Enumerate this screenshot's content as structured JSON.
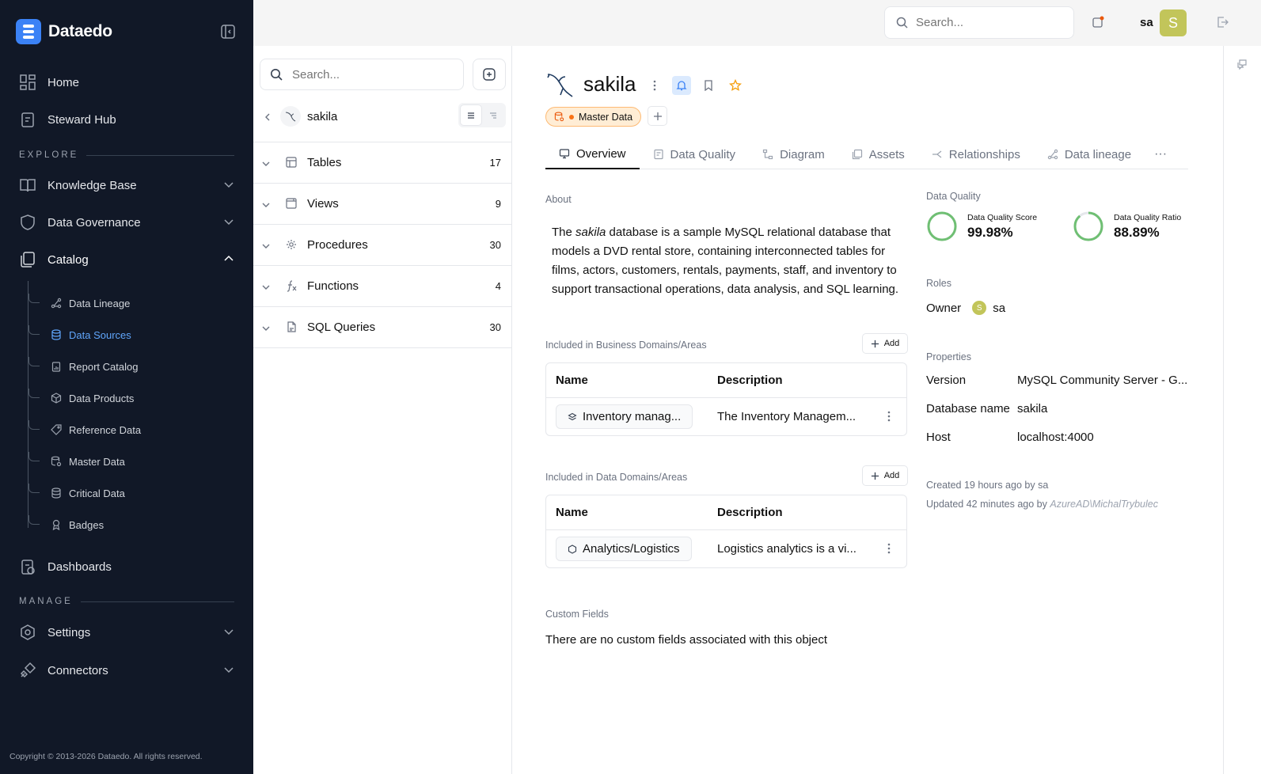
{
  "app": {
    "name": "Dataedo",
    "copyright": "Copyright © 2013-2026 Dataedo. All rights reserved."
  },
  "sidebar": {
    "home": "Home",
    "steward_hub": "Steward Hub",
    "explore_label": "EXPLORE",
    "knowledge_base": "Knowledge Base",
    "data_governance": "Data Governance",
    "catalog": "Catalog",
    "catalog_items": [
      "Data Lineage",
      "Data Sources",
      "Report Catalog",
      "Data Products",
      "Reference Data",
      "Master Data",
      "Critical Data",
      "Badges"
    ],
    "active_item": "Data Sources",
    "dashboards": "Dashboards",
    "manage_label": "MANAGE",
    "settings": "Settings",
    "connectors": "Connectors"
  },
  "topbar": {
    "search_placeholder": "Search...",
    "user": "sa",
    "avatar_letter": "S"
  },
  "tree": {
    "search_placeholder": "Search...",
    "title": "sakila",
    "rows": [
      {
        "label": "Tables",
        "count": "17"
      },
      {
        "label": "Views",
        "count": "9"
      },
      {
        "label": "Procedures",
        "count": "30"
      },
      {
        "label": "Functions",
        "count": "4"
      },
      {
        "label": "SQL Queries",
        "count": "30"
      }
    ]
  },
  "object": {
    "title": "sakila",
    "badge": "Master Data",
    "tabs": [
      "Overview",
      "Data Quality",
      "Diagram",
      "Assets",
      "Relationships",
      "Data lineage"
    ],
    "active_tab": "Overview",
    "about_label": "About",
    "about_pre": "The ",
    "about_em": "sakila",
    "about_post": " database is a sample MySQL relational database that models a DVD rental store, containing interconnected tables for films, actors, customers, rentals, payments, staff, and inventory to support transactional operations, data analysis, and SQL learning.",
    "business_domains": {
      "label": "Included in Business Domains/Areas",
      "add": "Add",
      "col_name": "Name",
      "col_desc": "Description",
      "row_name": "Inventory manag...",
      "row_desc": "The Inventory Managem..."
    },
    "data_domains": {
      "label": "Included in Data Domains/Areas",
      "add": "Add",
      "col_name": "Name",
      "col_desc": "Description",
      "row_name": "Analytics/Logistics",
      "row_desc": "Logistics analytics is a vi..."
    },
    "custom_fields_label": "Custom Fields",
    "custom_fields_empty": "There are no custom fields associated with this object"
  },
  "details": {
    "dq_label": "Data Quality",
    "dq_score_label": "Data Quality Score",
    "dq_score": "99.98%",
    "dq_score_fraction": 0.9998,
    "dq_ratio_label": "Data Quality Ratio",
    "dq_ratio": "88.89%",
    "dq_ratio_fraction": 0.8889,
    "roles_label": "Roles",
    "owner_label": "Owner",
    "owner_initial": "S",
    "owner_name": "sa",
    "properties_label": "Properties",
    "version_label": "Version",
    "version_value": "MySQL Community Server - G...",
    "dbname_label": "Database name",
    "dbname_value": "sakila",
    "host_label": "Host",
    "host_value": "localhost:4000",
    "created": "Created 19 hours ago by sa",
    "updated_pre": "Updated 42 minutes ago by ",
    "updated_by": "AzureAD\\MichalTrybulec"
  },
  "colors": {
    "sidebar_bg": "#111827",
    "accent": "#3b82f6",
    "dq_green": "#6fbf73",
    "badge_orange": "#f97316"
  }
}
